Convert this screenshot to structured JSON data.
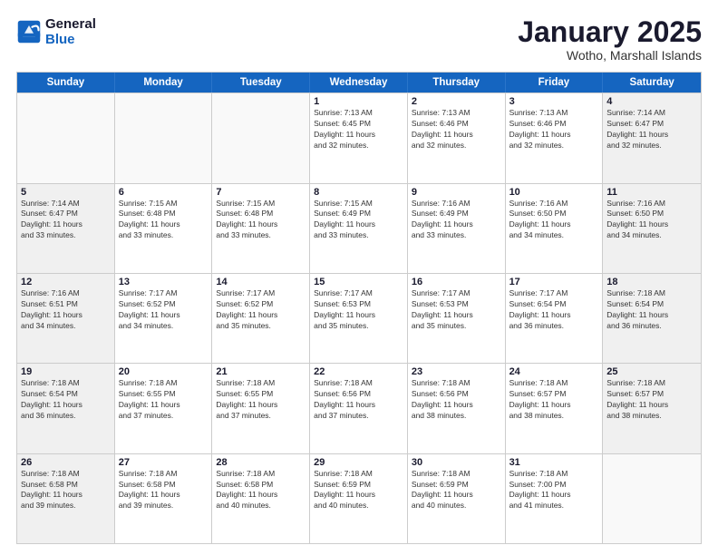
{
  "header": {
    "logo_line1": "General",
    "logo_line2": "Blue",
    "month_title": "January 2025",
    "location": "Wotho, Marshall Islands"
  },
  "days_of_week": [
    "Sunday",
    "Monday",
    "Tuesday",
    "Wednesday",
    "Thursday",
    "Friday",
    "Saturday"
  ],
  "weeks": [
    [
      {
        "day": "",
        "info": ""
      },
      {
        "day": "",
        "info": ""
      },
      {
        "day": "",
        "info": ""
      },
      {
        "day": "1",
        "info": "Sunrise: 7:13 AM\nSunset: 6:45 PM\nDaylight: 11 hours\nand 32 minutes."
      },
      {
        "day": "2",
        "info": "Sunrise: 7:13 AM\nSunset: 6:46 PM\nDaylight: 11 hours\nand 32 minutes."
      },
      {
        "day": "3",
        "info": "Sunrise: 7:13 AM\nSunset: 6:46 PM\nDaylight: 11 hours\nand 32 minutes."
      },
      {
        "day": "4",
        "info": "Sunrise: 7:14 AM\nSunset: 6:47 PM\nDaylight: 11 hours\nand 32 minutes."
      }
    ],
    [
      {
        "day": "5",
        "info": "Sunrise: 7:14 AM\nSunset: 6:47 PM\nDaylight: 11 hours\nand 33 minutes."
      },
      {
        "day": "6",
        "info": "Sunrise: 7:15 AM\nSunset: 6:48 PM\nDaylight: 11 hours\nand 33 minutes."
      },
      {
        "day": "7",
        "info": "Sunrise: 7:15 AM\nSunset: 6:48 PM\nDaylight: 11 hours\nand 33 minutes."
      },
      {
        "day": "8",
        "info": "Sunrise: 7:15 AM\nSunset: 6:49 PM\nDaylight: 11 hours\nand 33 minutes."
      },
      {
        "day": "9",
        "info": "Sunrise: 7:16 AM\nSunset: 6:49 PM\nDaylight: 11 hours\nand 33 minutes."
      },
      {
        "day": "10",
        "info": "Sunrise: 7:16 AM\nSunset: 6:50 PM\nDaylight: 11 hours\nand 34 minutes."
      },
      {
        "day": "11",
        "info": "Sunrise: 7:16 AM\nSunset: 6:50 PM\nDaylight: 11 hours\nand 34 minutes."
      }
    ],
    [
      {
        "day": "12",
        "info": "Sunrise: 7:16 AM\nSunset: 6:51 PM\nDaylight: 11 hours\nand 34 minutes."
      },
      {
        "day": "13",
        "info": "Sunrise: 7:17 AM\nSunset: 6:52 PM\nDaylight: 11 hours\nand 34 minutes."
      },
      {
        "day": "14",
        "info": "Sunrise: 7:17 AM\nSunset: 6:52 PM\nDaylight: 11 hours\nand 35 minutes."
      },
      {
        "day": "15",
        "info": "Sunrise: 7:17 AM\nSunset: 6:53 PM\nDaylight: 11 hours\nand 35 minutes."
      },
      {
        "day": "16",
        "info": "Sunrise: 7:17 AM\nSunset: 6:53 PM\nDaylight: 11 hours\nand 35 minutes."
      },
      {
        "day": "17",
        "info": "Sunrise: 7:17 AM\nSunset: 6:54 PM\nDaylight: 11 hours\nand 36 minutes."
      },
      {
        "day": "18",
        "info": "Sunrise: 7:18 AM\nSunset: 6:54 PM\nDaylight: 11 hours\nand 36 minutes."
      }
    ],
    [
      {
        "day": "19",
        "info": "Sunrise: 7:18 AM\nSunset: 6:54 PM\nDaylight: 11 hours\nand 36 minutes."
      },
      {
        "day": "20",
        "info": "Sunrise: 7:18 AM\nSunset: 6:55 PM\nDaylight: 11 hours\nand 37 minutes."
      },
      {
        "day": "21",
        "info": "Sunrise: 7:18 AM\nSunset: 6:55 PM\nDaylight: 11 hours\nand 37 minutes."
      },
      {
        "day": "22",
        "info": "Sunrise: 7:18 AM\nSunset: 6:56 PM\nDaylight: 11 hours\nand 37 minutes."
      },
      {
        "day": "23",
        "info": "Sunrise: 7:18 AM\nSunset: 6:56 PM\nDaylight: 11 hours\nand 38 minutes."
      },
      {
        "day": "24",
        "info": "Sunrise: 7:18 AM\nSunset: 6:57 PM\nDaylight: 11 hours\nand 38 minutes."
      },
      {
        "day": "25",
        "info": "Sunrise: 7:18 AM\nSunset: 6:57 PM\nDaylight: 11 hours\nand 38 minutes."
      }
    ],
    [
      {
        "day": "26",
        "info": "Sunrise: 7:18 AM\nSunset: 6:58 PM\nDaylight: 11 hours\nand 39 minutes."
      },
      {
        "day": "27",
        "info": "Sunrise: 7:18 AM\nSunset: 6:58 PM\nDaylight: 11 hours\nand 39 minutes."
      },
      {
        "day": "28",
        "info": "Sunrise: 7:18 AM\nSunset: 6:58 PM\nDaylight: 11 hours\nand 40 minutes."
      },
      {
        "day": "29",
        "info": "Sunrise: 7:18 AM\nSunset: 6:59 PM\nDaylight: 11 hours\nand 40 minutes."
      },
      {
        "day": "30",
        "info": "Sunrise: 7:18 AM\nSunset: 6:59 PM\nDaylight: 11 hours\nand 40 minutes."
      },
      {
        "day": "31",
        "info": "Sunrise: 7:18 AM\nSunset: 7:00 PM\nDaylight: 11 hours\nand 41 minutes."
      },
      {
        "day": "",
        "info": ""
      }
    ]
  ]
}
